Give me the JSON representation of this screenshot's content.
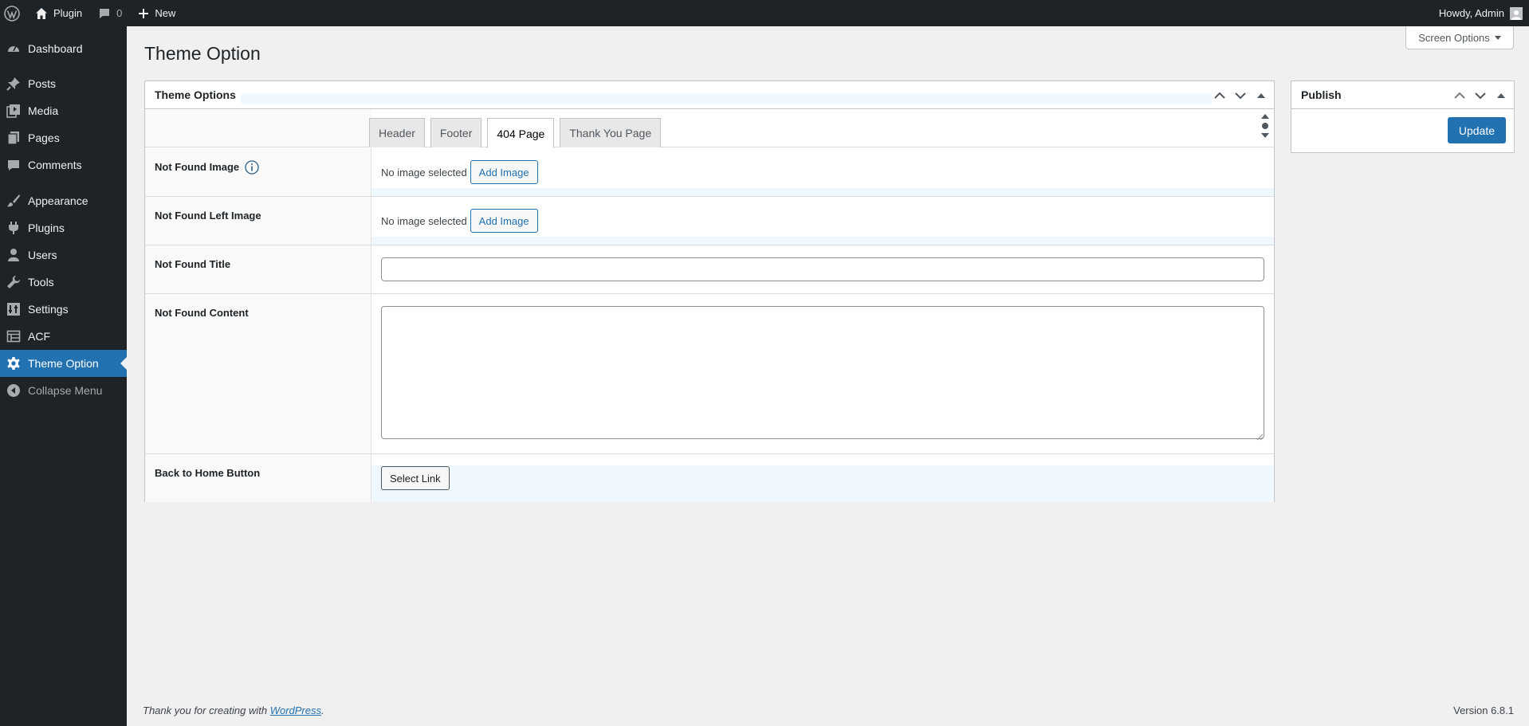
{
  "adminbar": {
    "site_name": "Plugin",
    "comments_count": "0",
    "new_label": "New",
    "howdy": "Howdy, Admin"
  },
  "sidebar": {
    "items": [
      {
        "label": "Dashboard",
        "icon": "dashboard-icon"
      },
      {
        "label": "Posts",
        "icon": "pin-icon"
      },
      {
        "label": "Media",
        "icon": "media-icon"
      },
      {
        "label": "Pages",
        "icon": "pages-icon"
      },
      {
        "label": "Comments",
        "icon": "comment-icon"
      },
      {
        "label": "Appearance",
        "icon": "brush-icon"
      },
      {
        "label": "Plugins",
        "icon": "plugin-icon"
      },
      {
        "label": "Users",
        "icon": "user-icon"
      },
      {
        "label": "Tools",
        "icon": "wrench-icon"
      },
      {
        "label": "Settings",
        "icon": "settings-icon"
      },
      {
        "label": "ACF",
        "icon": "acf-icon"
      },
      {
        "label": "Theme Option",
        "icon": "gear-icon",
        "current": true
      },
      {
        "label": "Collapse Menu",
        "icon": "collapse-icon"
      }
    ]
  },
  "page": {
    "title": "Theme Option",
    "screen_options": "Screen Options"
  },
  "theme_options": {
    "title": "Theme Options",
    "tabs": [
      "Header",
      "Footer",
      "404 Page",
      "Thank You Page"
    ],
    "active_tab": "404 Page",
    "fields": {
      "not_found_image": {
        "label": "Not Found Image",
        "status": "No image selected",
        "button": "Add Image"
      },
      "not_found_left_image": {
        "label": "Not Found Left Image",
        "status": "No image selected",
        "button": "Add Image"
      },
      "not_found_title": {
        "label": "Not Found Title",
        "value": ""
      },
      "not_found_content": {
        "label": "Not Found Content",
        "value": ""
      },
      "back_to_home": {
        "label": "Back to Home Button",
        "button": "Select Link"
      }
    }
  },
  "publish": {
    "title": "Publish",
    "update_label": "Update"
  },
  "footer": {
    "thanks_prefix": "Thank you for creating with",
    "wordpress_link": "WordPress",
    "thanks_suffix": ".",
    "version": "Version 6.8.1"
  },
  "colors": {
    "admin_dark": "#1d2327",
    "accent": "#2271b1",
    "background": "#f0f0f1"
  }
}
